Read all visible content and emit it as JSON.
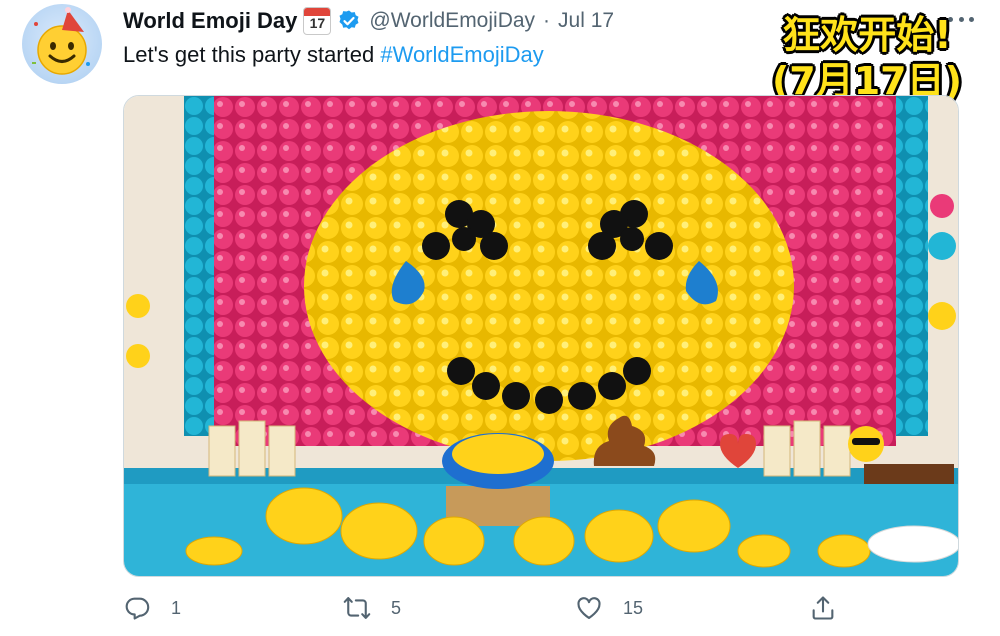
{
  "tweet": {
    "display_name": "World Emoji Day",
    "calendar_day": "17",
    "handle": "@WorldEmojiDay",
    "separator": "·",
    "date": "Jul 17",
    "text": "Let's get this party started ",
    "hashtag": "#WorldEmojiDay"
  },
  "overlay": {
    "line1": "狂欢开始!",
    "line2": "(7月17日)",
    "color": "#ffe21a"
  },
  "media": {
    "description_icon": "emoji-balloon-wall-photo"
  },
  "actions": {
    "reply_count": "1",
    "retweet_count": "5",
    "like_count": "15"
  },
  "colors": {
    "accent": "#1d9bf0",
    "secondary_text": "#536471"
  }
}
